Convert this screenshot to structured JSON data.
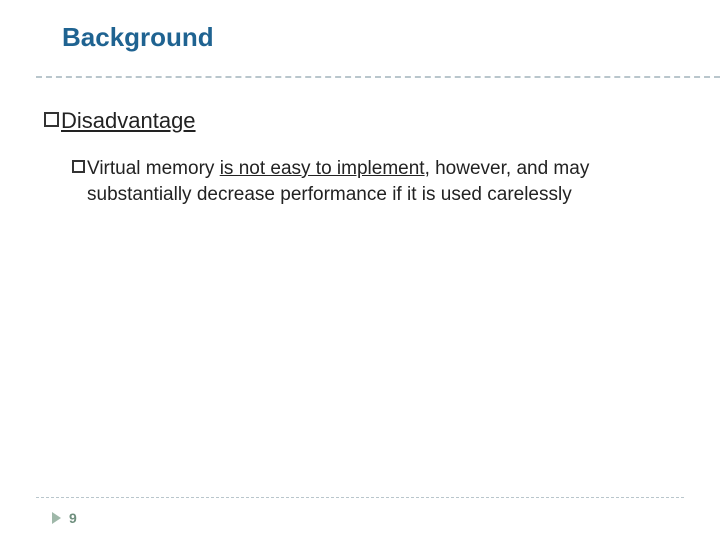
{
  "title": "Background",
  "bullet": {
    "label": "Disadvantage"
  },
  "sub": {
    "pre": "Virtual memory ",
    "underlined": "is not easy to implement",
    "post": ", however, and may substantially decrease performance if it is used carelessly"
  },
  "page": "9"
}
